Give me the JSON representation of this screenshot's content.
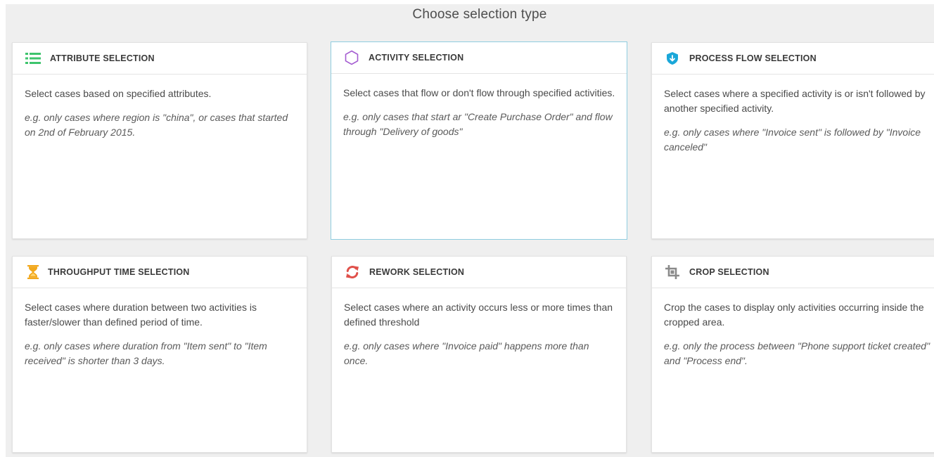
{
  "page": {
    "title": "Choose selection type"
  },
  "colors": {
    "attribute_icon": "#3ec46d",
    "activity_icon": "#a45cd1",
    "process_flow_icon": "#1aa7d9",
    "throughput_icon": "#f2a81d",
    "rework_icon": "#e0504a",
    "crop_icon": "#8a8a8a",
    "selected_border": "#8fcde0"
  },
  "cards": [
    {
      "title": "ATTRIBUTE SELECTION",
      "icon": "list-icon",
      "description": "Select cases based on specified attributes.",
      "example": "e.g. only cases where region is \"china\", or cases that started on 2nd of February 2015."
    },
    {
      "title": "ACTIVITY SELECTION",
      "icon": "hexagon-icon",
      "description": "Select cases that flow or don't flow through specified activities.",
      "example": "e.g. only cases that start ar \"Create Purchase Order\" and flow through \"Delivery of goods\""
    },
    {
      "title": "PROCESS FLOW SELECTION",
      "icon": "shield-arrow-icon",
      "description": "Select cases where a specified activity is or isn't followed by another specified activity.",
      "example": "e.g. only cases where \"Invoice sent\" is followed by \"Invoice canceled\""
    },
    {
      "title": "THROUGHPUT TIME SELECTION",
      "icon": "hourglass-icon",
      "description": "Select cases where duration between two activities is faster/slower than defined period of time.",
      "example": "e.g. only cases where duration from \"Item sent\" to \"Item received\" is shorter than 3 days."
    },
    {
      "title": "REWORK SELECTION",
      "icon": "refresh-icon",
      "description": "Select cases where an activity occurs less or more times than defined threshold",
      "example": "e.g. only cases where \"Invoice paid\" happens more than once."
    },
    {
      "title": "CROP SELECTION",
      "icon": "crop-icon",
      "description": "Crop the cases to display only activities occurring inside the cropped area.",
      "example": "e.g. only the process between \"Phone support ticket created\" and \"Process end\"."
    }
  ]
}
